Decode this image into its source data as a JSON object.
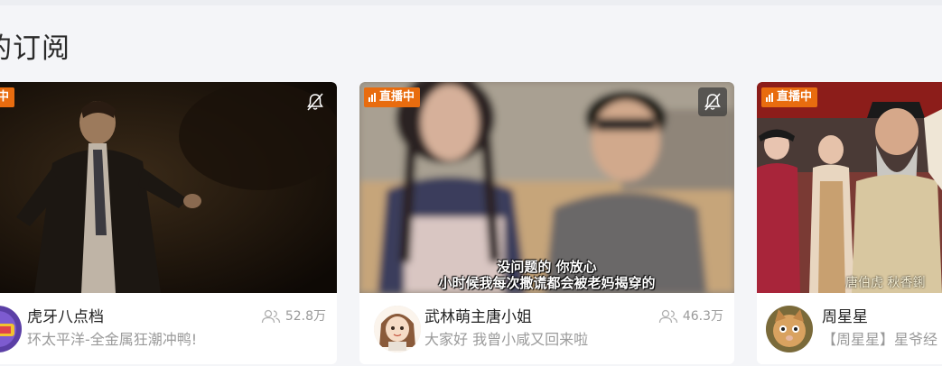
{
  "section": {
    "title": "的订阅"
  },
  "live_label": "直播中",
  "cards": [
    {
      "streamer": "虎牙八点档",
      "title": "环太平洋-全金属狂潮冲鸭!",
      "viewers": "52.8万",
      "mute_boxed": false,
      "subtitle_lines": [],
      "corner_caption": ""
    },
    {
      "streamer": "武林萌主唐小姐",
      "title": "大家好 我曾小咸又回来啦",
      "viewers": "46.3万",
      "mute_boxed": true,
      "subtitle_lines": [
        "没问题的 你放心",
        "小时候我每次撒谎都会被老妈揭穿的"
      ],
      "corner_caption": ""
    },
    {
      "streamer": "周星星",
      "title": "【周星星】星爷经",
      "viewers": "",
      "mute_boxed": false,
      "subtitle_lines": [],
      "corner_caption": "唐伯虎 秋香鋓"
    }
  ]
}
